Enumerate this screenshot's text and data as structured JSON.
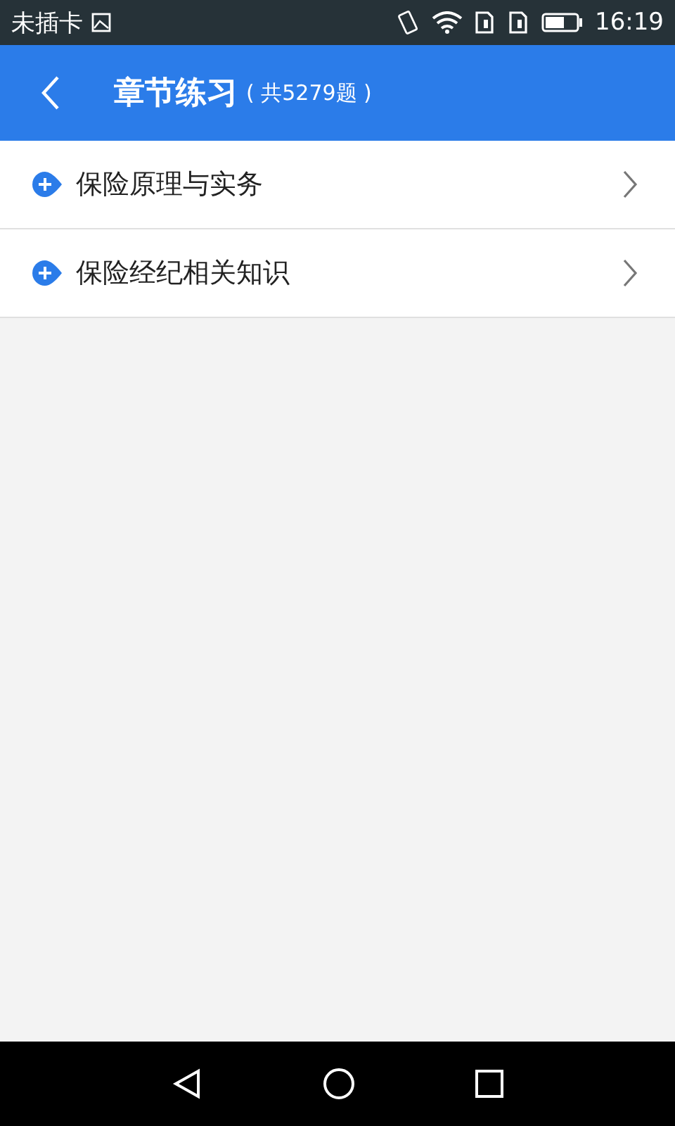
{
  "status_bar": {
    "carrier": "未插卡",
    "time": "16:19"
  },
  "header": {
    "title": "章节练习",
    "count": "( 共5279题 )"
  },
  "items": [
    {
      "label": "保险原理与实务"
    },
    {
      "label": "保险经纪相关知识"
    }
  ]
}
